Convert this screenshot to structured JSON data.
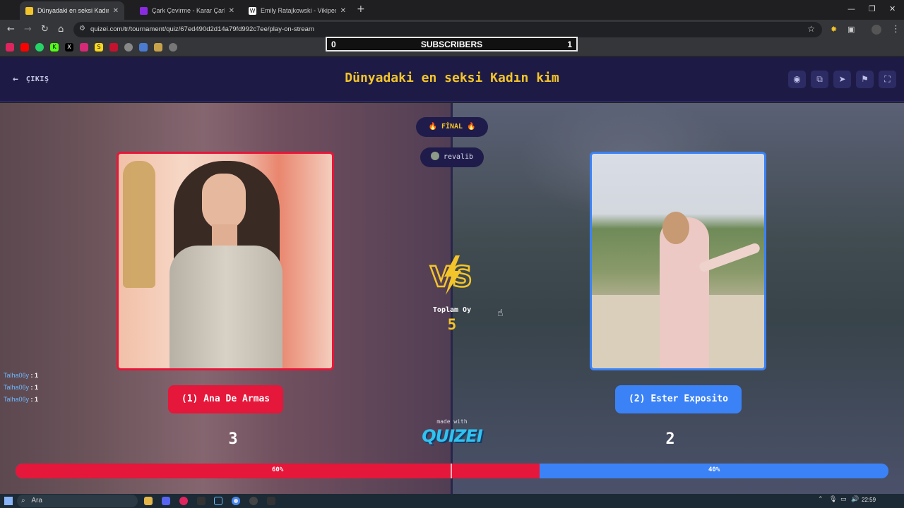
{
  "browser": {
    "tabs": [
      {
        "label": "Dünyadaki en seksi Kadın kim -",
        "active": true,
        "favicon_color": "#f4c52a"
      },
      {
        "label": "Çark Çevirme - Karar Çarkı!",
        "active": false,
        "favicon_color": "#8a2be2"
      },
      {
        "label": "Emily Ratajkowski - Vikipedi",
        "active": false,
        "favicon_color": "#ffffff"
      }
    ],
    "url": "quizei.com/tr/tournament/quiz/67ed490d2d14a79fd992c7ee/play-on-stream"
  },
  "subscribers": {
    "left": "0",
    "label": "SUBSCRIBERS",
    "right": "1"
  },
  "header": {
    "exit_label": "ÇIKIŞ",
    "title": "Dünyadaki en seksi Kadın kim",
    "icons": [
      "eye-icon",
      "share-icon",
      "send-icon",
      "flag-icon",
      "fullscreen-icon"
    ]
  },
  "round": {
    "label": "🔥 FİNAL 🔥",
    "streamer": "revalib"
  },
  "vs": {
    "total_label": "Toplam Oy",
    "total_value": "5"
  },
  "contestants": [
    {
      "button_label": "(1) Ana De Armas",
      "votes": "3",
      "color": "#e5173a"
    },
    {
      "button_label": "(2) Ester Exposito",
      "votes": "2",
      "color": "#3b82f6"
    }
  ],
  "chat": [
    {
      "user": "Talha06y",
      "vote": "1"
    },
    {
      "user": "Talha06y",
      "vote": "1"
    },
    {
      "user": "Talha06y",
      "vote": "1"
    }
  ],
  "branding": {
    "made_with": "made with",
    "brand": "QUIZEI"
  },
  "progress": {
    "left_label": "60%",
    "right_label": "40%",
    "left_fraction": 0.6
  },
  "taskbar": {
    "search_placeholder": "Ara",
    "time": "22:59"
  }
}
